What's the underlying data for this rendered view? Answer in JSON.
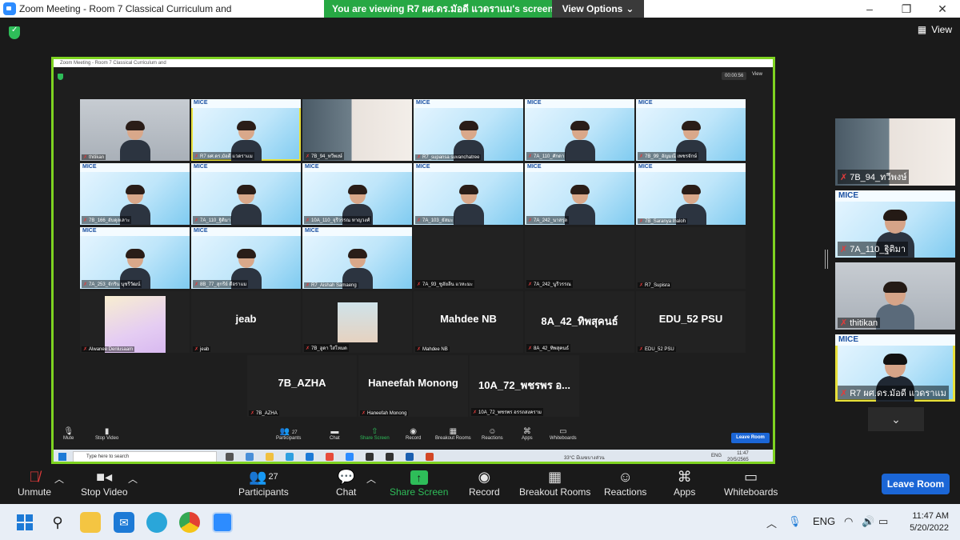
{
  "window": {
    "title": "Zoom Meeting - Room 7 Classical Curriculum and",
    "viewing_banner": "You are viewing R7 ผศ.ดร.มัอดี แวดราแม's screen",
    "view_options": "View Options",
    "view_label": "View",
    "controls": [
      "–",
      "❐",
      "✕"
    ]
  },
  "shared_screen": {
    "title": "Zoom Meeting - Room 7 Classical Curriculum and",
    "timer": "00:00:56",
    "view": "View",
    "tiles": [
      {
        "name": "thitikan",
        "big": ""
      },
      {
        "name": "R7 ผศ.ดร.มัอดี แวดราแม",
        "big": ""
      },
      {
        "name": "7B_94_ทวีพงษ์",
        "big": ""
      },
      {
        "name": "R7_supansa suvanchatree",
        "big": ""
      },
      {
        "name": "7A_110_ศักดา",
        "big": ""
      },
      {
        "name": "7B_99_อัญมณี เพชรจักษ์",
        "big": ""
      },
      {
        "name": "7B_166_อับดุลเลาะ",
        "big": ""
      },
      {
        "name": "7A_110_ฐิติมา",
        "big": ""
      },
      {
        "name": "10A_110_จุรีวรรณ หาญวงศ์",
        "big": ""
      },
      {
        "name": "7A_103_ยัสมะ",
        "big": ""
      },
      {
        "name": "7A_242_นาสรุล",
        "big": ""
      },
      {
        "name": "7B_Saranya Ihaloh",
        "big": ""
      },
      {
        "name": "7A_253_จักริน นุชรีวัฒน์",
        "big": ""
      },
      {
        "name": "8B_77_สุกรีย์ ดือราแม",
        "big": ""
      },
      {
        "name": "R7_Aishah Samaeng",
        "big": ""
      },
      {
        "name": "7A_93_ซูฮัยลีน แวหะมะ",
        "big": ""
      },
      {
        "name": "7A_242_นูรีวรรณ",
        "big": ""
      },
      {
        "name": "R7_Supisra",
        "big": ""
      },
      {
        "name": "Alwanee Denlusaam",
        "big": ""
      },
      {
        "name": "jeab",
        "big": "jeab"
      },
      {
        "name": "7B_ฮูดา ใส่โหมด",
        "big": ""
      },
      {
        "name": "Mahdee NB",
        "big": "Mahdee NB"
      },
      {
        "name": "8A_42_ทิพสุคนธ์",
        "big": "8A_42_ทิพสุคนธ์"
      },
      {
        "name": "EDU_52 PSU",
        "big": "EDU_52 PSU"
      },
      {
        "name": "7B_AZHA",
        "big": "7B_AZHA"
      },
      {
        "name": "Haneefah Monong",
        "big": "Haneefah Monong"
      },
      {
        "name": "10A_72_พชรพร อรรถสงคราม",
        "big": "10A_72_พชรพร อ..."
      }
    ],
    "toolbar": {
      "mute": "Mute",
      "stop_video": "Stop Video",
      "participants": "Participants",
      "participants_count": "27",
      "chat": "Chat",
      "share": "Share Screen",
      "record": "Record",
      "breakout": "Breakout Rooms",
      "reactions": "Reactions",
      "apps": "Apps",
      "whiteboards": "Whiteboards",
      "leave": "Leave Room"
    },
    "taskbar": {
      "search": "Type here to search",
      "weather": "33°C มีเมฆบางส่วน",
      "lang": "ENG",
      "time": "11:47",
      "date": "20/5/2565"
    }
  },
  "side_panel": [
    {
      "name": "7B_94_ทวีพงษ์"
    },
    {
      "name": "7A_110_ฐิติมา"
    },
    {
      "name": "thitikan"
    },
    {
      "name": "R7 ผศ.ดร.มัอดี แวดราแม"
    }
  ],
  "toolbar": {
    "unmute": "Unmute",
    "stop_video": "Stop Video",
    "participants": "Participants",
    "participants_count": "27",
    "chat": "Chat",
    "share_screen": "Share Screen",
    "record": "Record",
    "breakout": "Breakout Rooms",
    "reactions": "Reactions",
    "apps": "Apps",
    "whiteboards": "Whiteboards",
    "leave": "Leave Room"
  },
  "taskbar": {
    "lang": "ENG",
    "time": "11:47 AM",
    "date": "5/20/2022"
  },
  "colors": {
    "share_green": "#27a844",
    "leave_blue": "#1b66d6",
    "active_yellow": "#e8e03a"
  }
}
